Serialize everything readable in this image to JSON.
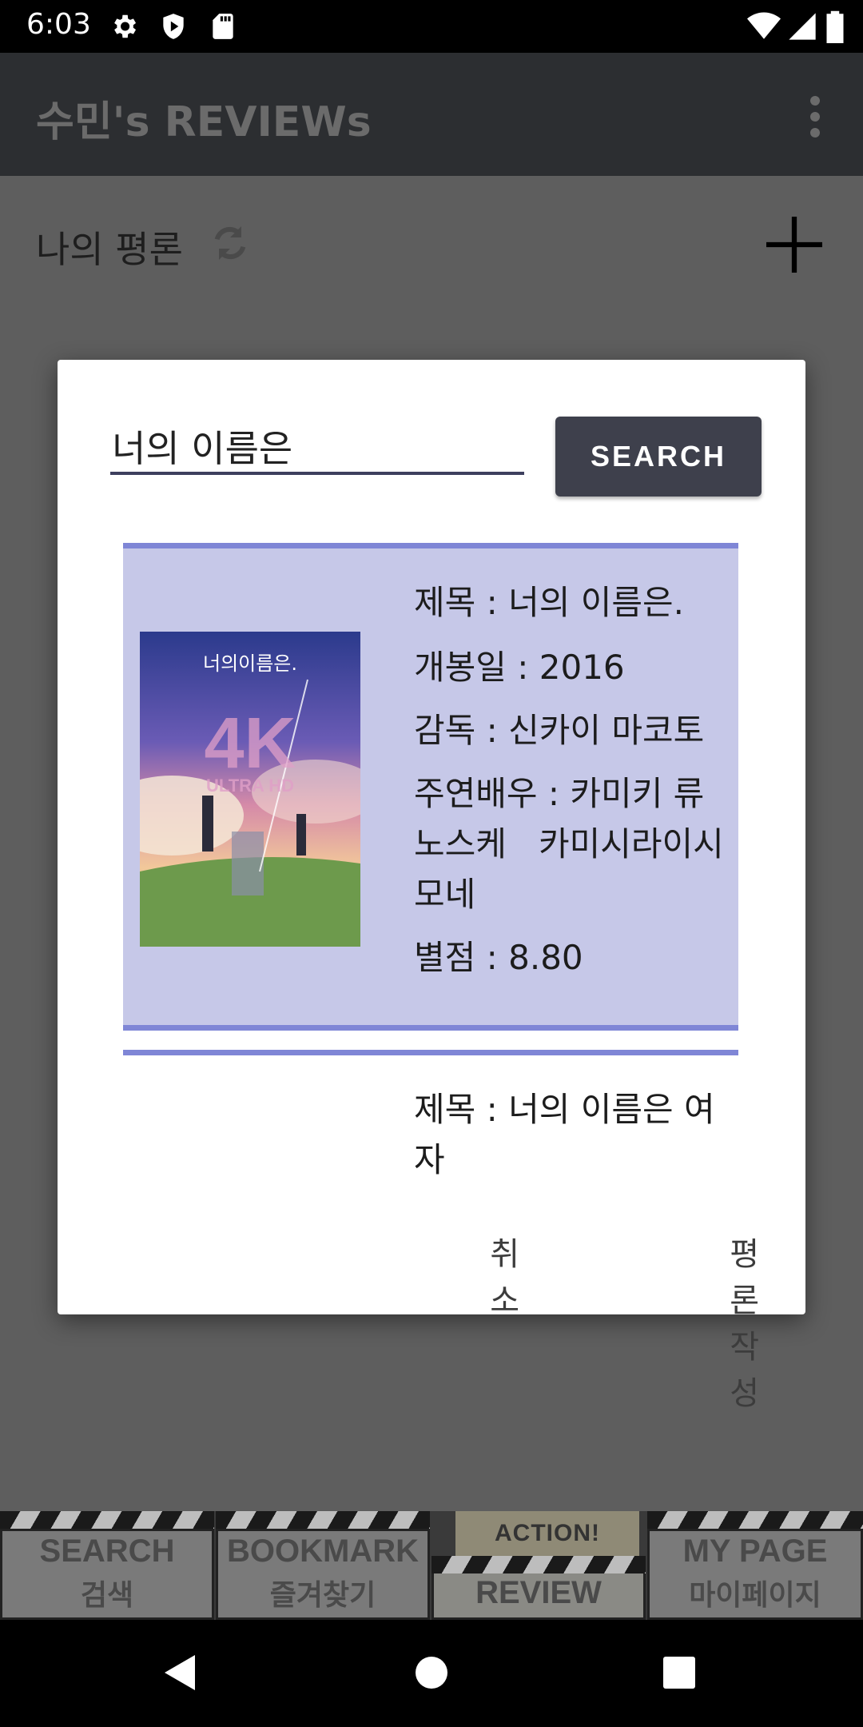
{
  "status_bar": {
    "time": "6:03",
    "icons": [
      "gear-icon",
      "shield-icon",
      "sd-card-icon",
      "wifi-icon",
      "signal-icon",
      "battery-icon"
    ]
  },
  "app_bar": {
    "title": "수민's REVIEWs",
    "overflow_icon": "more-vert-icon"
  },
  "content": {
    "section_title": "나의 평론",
    "refresh_icon": "refresh-icon",
    "add_icon": "add-icon"
  },
  "dialog": {
    "search_value": "너의 이름은",
    "search_button": "SEARCH",
    "results": [
      {
        "title_line": "제목 : 너의 이름은.",
        "release_line": "개봉일 : 2016",
        "director_line": "감독 : 신카이 마코토",
        "actors_line1": "주연배우 : 카미키 류",
        "actors_line2": "노스케   카미시라이시",
        "actors_line3": "모네",
        "rating_line": "별점 : 8.80",
        "poster_title": "너의이름은.",
        "poster_badge": "4K",
        "poster_sub": "ULTRA HD"
      },
      {
        "title_line1": "제목 : 너의 이름은 여",
        "title_line2": "자"
      }
    ],
    "cancel_button": "취소",
    "write_review_button": "평론 작성"
  },
  "tabs": [
    {
      "en": "SEARCH",
      "ko": "검색"
    },
    {
      "en": "BOOKMARK",
      "ko": "즐겨찾기"
    },
    {
      "en": "REVIEW",
      "action": "ACTION!"
    },
    {
      "en": "MY PAGE",
      "ko": "마이페이지"
    }
  ],
  "colors": {
    "scrim": "#5e5e5e",
    "app_bar": "#2c2e31",
    "search_button": "#3e404c",
    "card_bg": "#c6c8e8",
    "card_border": "#7f86d6"
  }
}
